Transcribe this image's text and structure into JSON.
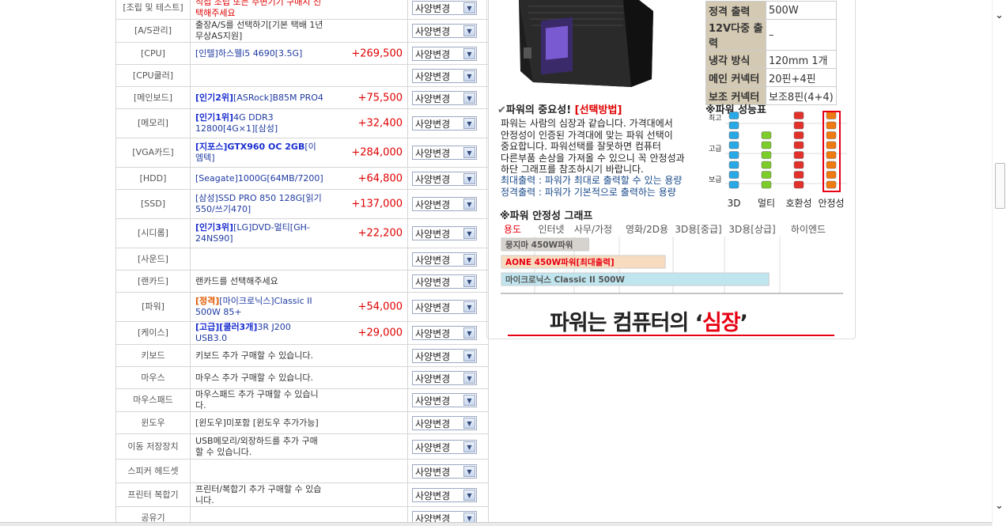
{
  "options": [
    {
      "label": "[조립 및 테스트]",
      "parts": [
        {
          "text": "직접 조립 또는 주변기기 구매시 선택해주세요",
          "cls": "red"
        }
      ],
      "price": "",
      "select": "사양변경",
      "h": 30
    },
    {
      "label": "[A/S관리]",
      "parts": [
        {
          "text": "출장A/S를 선택하기[기본 택배 1년 무상AS지원]",
          "cls": ""
        }
      ],
      "price": "",
      "select": "사양변경",
      "h": 29
    },
    {
      "label": "[CPU]",
      "parts": [
        {
          "text": "[인텔]하스웰i5 4690[3.5G]",
          "cls": "navy"
        }
      ],
      "price": "+269,500",
      "select": "사양변경",
      "h": 28
    },
    {
      "label": "[CPU쿨러]",
      "parts": [],
      "price": "",
      "select": "사양변경",
      "h": 28
    },
    {
      "label": "[메인보드]",
      "parts": [
        {
          "text": "[인기2위]",
          "cls": "blue b"
        },
        {
          "text": "[ASRock]B85M PRO4",
          "cls": "navy"
        }
      ],
      "price": "+75,500",
      "select": "사양변경",
      "h": 28
    },
    {
      "label": "[메모리]",
      "parts": [
        {
          "text": "[인기1위]",
          "cls": "blue b"
        },
        {
          "text": "4G DDR3 12800[4G×1][삼성]",
          "cls": "navy"
        }
      ],
      "price": "+32,400",
      "select": "사양변경",
      "h": 37
    },
    {
      "label": "[VGA카드]",
      "parts": [
        {
          "text": "[지포스]GTX960 OC 2GB",
          "cls": "blue b"
        },
        {
          "text": "[이엠텍]",
          "cls": "navy"
        }
      ],
      "price": "+284,000",
      "select": "사양변경",
      "h": 37
    },
    {
      "label": "[HDD]",
      "parts": [
        {
          "text": "[Seagate]1000G[64MB/7200]",
          "cls": "navy"
        }
      ],
      "price": "+64,800",
      "select": "사양변경",
      "h": 28
    },
    {
      "label": "[SSD]",
      "parts": [
        {
          "text": "[삼성]SSD PRO 850 128G[읽기550/쓰기470]",
          "cls": "navy"
        }
      ],
      "price": "+137,000",
      "select": "사양변경",
      "h": 37
    },
    {
      "label": "[시디롬]",
      "parts": [
        {
          "text": "[인기3위]",
          "cls": "blue b"
        },
        {
          "text": "[LG]DVD-멀티[GH-24NS90]",
          "cls": "navy"
        }
      ],
      "price": "+22,200",
      "select": "사양변경",
      "h": 37
    },
    {
      "label": "[사운드]",
      "parts": [],
      "price": "",
      "select": "사양변경",
      "h": 28
    },
    {
      "label": "[랜카드]",
      "parts": [
        {
          "text": "랜카드를 선택해주세요",
          "cls": ""
        }
      ],
      "price": "",
      "select": "사양변경",
      "h": 28
    },
    {
      "label": "[파워]",
      "parts": [
        {
          "text": "[정격]",
          "cls": "orange b"
        },
        {
          "text": "[마이크로닉스]Classic II 500W 85+",
          "cls": "navy"
        }
      ],
      "price": "+54,000",
      "select": "사양변경",
      "h": 37
    },
    {
      "label": "[케이스]",
      "parts": [
        {
          "text": "[고급][쿨러3개]",
          "cls": "blue b"
        },
        {
          "text": "3R J200 USB3.0",
          "cls": "navy"
        }
      ],
      "price": "+29,000",
      "select": "사양변경",
      "h": 28
    },
    {
      "label": "키보드",
      "parts": [
        {
          "text": "키보드 추가 구매할 수 있습니다.",
          "cls": ""
        }
      ],
      "price": "",
      "select": "사양변경",
      "h": 28
    },
    {
      "label": "마우스",
      "parts": [
        {
          "text": "마우스 추가 구매할 수 있습니다.",
          "cls": ""
        }
      ],
      "price": "",
      "select": "사양변경",
      "h": 28
    },
    {
      "label": "마우스패드",
      "parts": [
        {
          "text": "마우스패드 추가 구매할 수 있습니다.",
          "cls": ""
        }
      ],
      "price": "",
      "select": "사양변경",
      "h": 28
    },
    {
      "label": "윈도우",
      "parts": [
        {
          "text": "[윈도우]미포함 [윈도우 추가가능]",
          "cls": ""
        }
      ],
      "price": "",
      "select": "사양변경",
      "h": 28
    },
    {
      "label": "이동 저장장치",
      "parts": [
        {
          "text": "USB메모리/외장하드를 추가 구매할 수 있습니다.",
          "cls": ""
        }
      ],
      "price": "",
      "select": "사양변경",
      "h": 32
    },
    {
      "label": "스피커 헤드셋",
      "parts": [],
      "price": "",
      "select": "사양변경",
      "h": 30
    },
    {
      "label": "프린터 복합기",
      "parts": [
        {
          "text": "프린터/복합기 추가 구매할 수 있습니다.",
          "cls": ""
        }
      ],
      "price": "",
      "select": "사양변경",
      "h": 30
    },
    {
      "label": "공유기",
      "parts": [
        {
          "text": "",
          "cls": ""
        }
      ],
      "price": "",
      "select": "사양변경",
      "h": 28
    }
  ],
  "spec": [
    {
      "k": "정격 출력",
      "v": "500W"
    },
    {
      "k": "12V다중 출력",
      "v": "–"
    },
    {
      "k": "냉각 방식",
      "v": "120mm 1개"
    },
    {
      "k": "메인 커넥터",
      "v": "20핀+4핀"
    },
    {
      "k": "보조 커넥터",
      "v": "보조8핀(4+4)"
    }
  ],
  "importance": {
    "title": "파워의 중요성!",
    "title_link": "[선택방법]",
    "body": [
      "파워는 사람의 심장과 같습니다. 가격대에서",
      "안정성이 인증된 가격대에 맞는 파워 선택이",
      "중요합니다. 파워선택를 잘못하면 컴퓨터",
      "다른부품 손상을 가져올 수 있으니 꼭 안정성과",
      "하단 그래프를 참조하시기 바랍니다."
    ],
    "notes": [
      "최대출력 : 파워가 최대로 출력할 수 있는 용량",
      "정격출력 : 파워가 기본적으로 출력하는 용량"
    ]
  },
  "perf": {
    "title": "※파워 성능표",
    "levels": [
      "최고",
      "고급",
      "보급"
    ],
    "columns": [
      {
        "label": "3D",
        "level": 8,
        "color": "#29a8e6"
      },
      {
        "label": "멀티",
        "level": 6,
        "color": "#7dcd2a"
      },
      {
        "label": "호환성",
        "level": 8,
        "color": "#e2302a"
      },
      {
        "label": "안정성",
        "level": 9,
        "color": "#f07a12"
      }
    ],
    "max": 9,
    "highlight_color": "#e60012"
  },
  "chart_data": {
    "type": "bar",
    "title": "※파워 안정성 그래프",
    "categories": [
      "용도",
      "인터넷",
      "사무/가정",
      "영화/2D용",
      "3D용[중급]",
      "3D용[상급]",
      "하이엔드"
    ],
    "series": [
      {
        "name": "뭉지마 450W파워",
        "end": 1.6,
        "color": "#d6d2cd"
      },
      {
        "name": "AONE 450W파워[최대출력]",
        "end": 3.0,
        "color": "#f8dcc0"
      },
      {
        "name": "마이크로닉스 Classic II 500W",
        "end": 4.9,
        "color": "#bfe5ef"
      }
    ],
    "xlim": [
      0,
      6.3
    ]
  },
  "slogan": {
    "pre": "파워는 컴퓨터의 ‘",
    "hl": "심장",
    "post": "’"
  },
  "colors": {
    "accent": "#e60012",
    "specKey": "#d4cab4"
  }
}
